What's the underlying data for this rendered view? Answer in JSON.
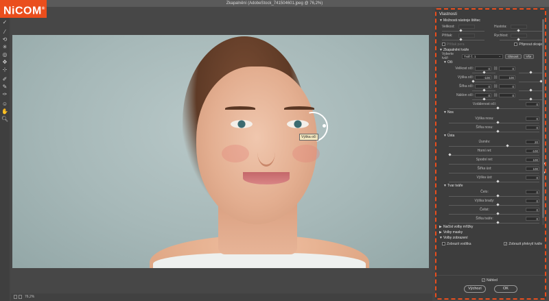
{
  "window": {
    "title": "Zkapalnění (AdobeStock_741504601.jpeg @ 76,2%)"
  },
  "logo": {
    "text": "NiCOM",
    "reg": "®"
  },
  "tools": [
    "check",
    "brush",
    "refresh",
    "warp",
    "pucker",
    "bloat",
    "mirror",
    "freeze",
    "thaw",
    "mask",
    "face",
    "hand",
    "zoom"
  ],
  "canvas": {
    "tooltip": "Výška očí"
  },
  "status": {
    "zoom": "76,2%"
  },
  "panel": {
    "title": "Vlastnosti",
    "brush_options": {
      "header": "Možnosti nástroje štětec",
      "left_labels": [
        "Velikost:",
        "Přítlak:"
      ],
      "right_labels": [
        "Hustota:",
        "Rychlost:"
      ],
      "stylus": "Přítlak pera",
      "pin": "Připnout okraje"
    },
    "face_aware": {
      "header": "Zkapalnění tváře",
      "select_label": "Vyberte tvář:",
      "select_value": "Tvář č. 1",
      "reset_btn": "Obnovit",
      "all_btn": "Vše",
      "eyes": {
        "header": "Oči",
        "rows": [
          {
            "label": "Velikost očí:",
            "left": "0",
            "right": "0"
          },
          {
            "label": "Výška očí:",
            "left": "-100",
            "right": "100"
          },
          {
            "label": "Šířka očí:",
            "left": "0",
            "right": "0"
          },
          {
            "label": "Náklon očí:",
            "left": "0",
            "right": "0"
          }
        ],
        "distance": {
          "label": "Vzdálenost očí:",
          "value": "0"
        }
      },
      "nose": {
        "header": "Nos",
        "rows": [
          {
            "label": "Výška nosu:",
            "value": "0"
          },
          {
            "label": "Šířka nosu:",
            "value": "0"
          }
        ]
      },
      "mouth": {
        "header": "Ústa",
        "rows": [
          {
            "label": "Úsměv:",
            "value": "20"
          },
          {
            "label": "Horní ret:",
            "value": "-100"
          },
          {
            "label": "Spodní ret:",
            "value": "100"
          },
          {
            "label": "Šířka úst:",
            "value": "100"
          },
          {
            "label": "Výška úst:",
            "value": "0"
          }
        ]
      },
      "face_shape": {
        "header": "Tvar tváře",
        "rows": [
          {
            "label": "Čelo:",
            "value": "0"
          },
          {
            "label": "Výška brady:",
            "value": "0"
          },
          {
            "label": "Čelist:",
            "value": "0"
          },
          {
            "label": "Šířka tváře:",
            "value": "0"
          }
        ]
      }
    },
    "collapsed": [
      "Načíst volby mřížky",
      "Volby masky",
      "Volby zobrazení"
    ],
    "view": {
      "show_guides": "Zobrazit vodítka",
      "show_face": "Zobrazit překrytí tváře"
    },
    "preview": "Náhled",
    "reset_button": "Výchozí",
    "ok_button": "OK"
  }
}
